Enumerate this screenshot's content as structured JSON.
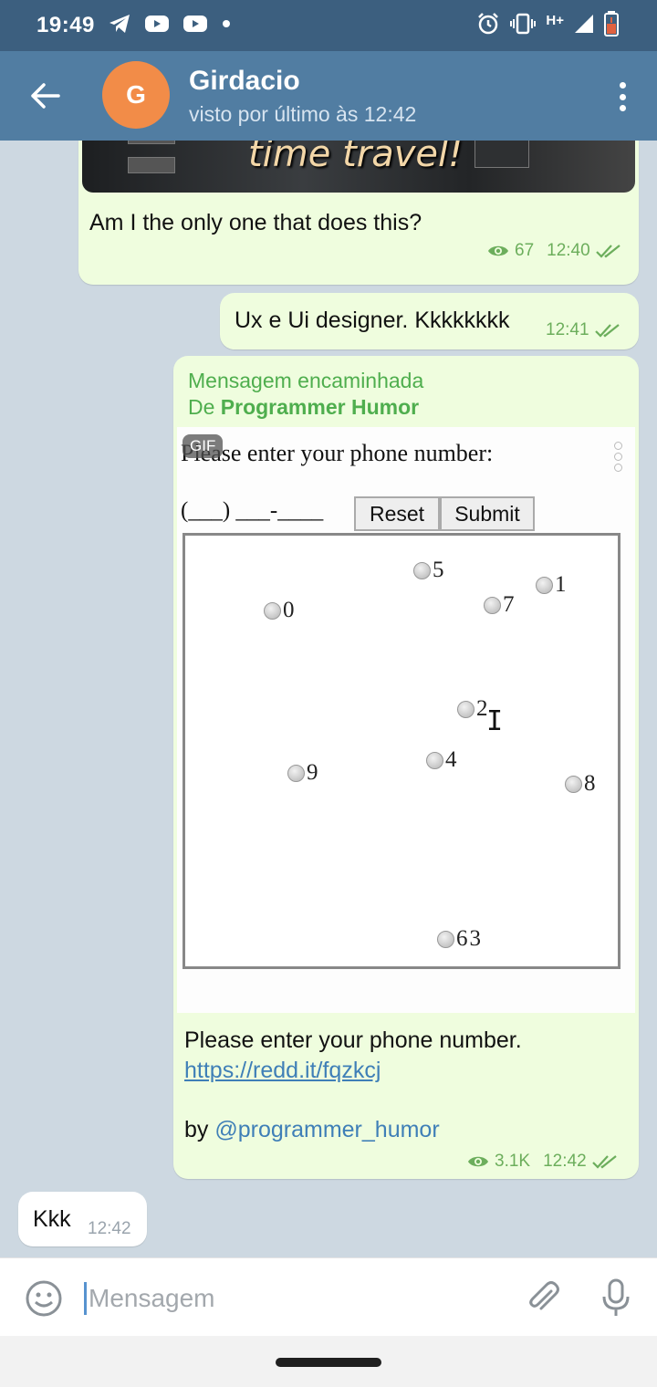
{
  "status_bar": {
    "time": "19:49",
    "network": "H+",
    "icons": [
      "telegram-icon",
      "youtube-icon",
      "youtube-icon",
      "dot-icon",
      "alarm-icon",
      "vibrate-icon",
      "signal-icon",
      "battery-low-icon"
    ]
  },
  "header": {
    "avatar_letter": "G",
    "name": "Girdacio",
    "status": "visto por último às 12:42",
    "avatar_color": "#f28c48",
    "bar_color": "#517da2"
  },
  "messages": [
    {
      "type": "outgoing",
      "media_caption": "time travel!",
      "text": "Am I the only one that does this?",
      "views": "67",
      "time": "12:40",
      "read": true
    },
    {
      "type": "outgoing",
      "text": "Ux e Ui designer. Kkkkkkkk",
      "time": "12:41",
      "read": true
    },
    {
      "type": "outgoing",
      "forwarded_label": "Mensagem encaminhada",
      "forwarded_prefix": "De",
      "forwarded_from": "Programmer Humor",
      "gif": {
        "badge": "GIF",
        "prompt": "Please enter your phone number:",
        "phone_mask": "(___) ___-____",
        "reset_label": "Reset",
        "submit_label": "Submit",
        "keys": [
          "5",
          "1",
          "0",
          "7",
          "2",
          "4",
          "9",
          "8",
          "6",
          "3"
        ]
      },
      "text": "Please enter your phone number.",
      "link": "https://redd.it/fqzkcj",
      "by_prefix": "by",
      "mention": "@programmer_humor",
      "views": "3.1K",
      "time": "12:42",
      "read": true
    },
    {
      "type": "incoming",
      "text": "Kkk",
      "time": "12:42"
    }
  ],
  "input": {
    "placeholder": "Mensagem"
  },
  "colors": {
    "outgoing_bubble": "#effdde",
    "incoming_bubble": "#ffffff",
    "accent_green": "#4fae4e",
    "link_blue": "#3f7fb7"
  }
}
